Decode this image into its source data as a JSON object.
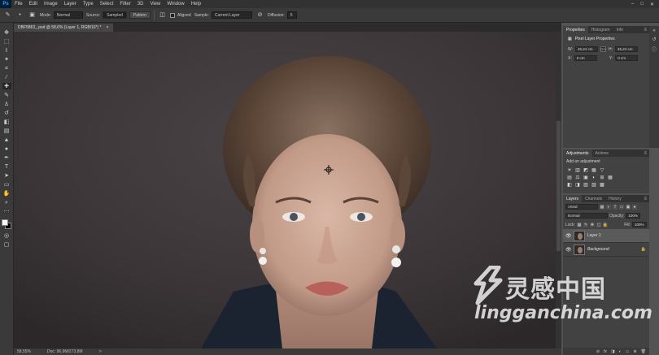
{
  "app": {
    "logo": "Ps"
  },
  "menu": [
    "File",
    "Edit",
    "Image",
    "Layer",
    "Type",
    "Select",
    "Filter",
    "3D",
    "View",
    "Window",
    "Help"
  ],
  "window_controls": [
    "–",
    "□",
    "✕"
  ],
  "options_bar": {
    "mode_label": "Mode:",
    "mode_value": "Normal",
    "source_label": "Source:",
    "sampled_label": "Sampled",
    "pattern_label": "Pattern",
    "aligned_label": "Aligned",
    "sample_label": "Sample:",
    "sample_value": "Current Layer",
    "diffusion_label": "Diffusion:",
    "diffusion_value": "5"
  },
  "document": {
    "tab_title": "DBF5863_.psd @ 58,6% (Layer 1, RGB/16*) *",
    "tab_close": "×"
  },
  "status": {
    "zoom": "58,55%",
    "doc": "Doc: 96,9M/273,8M",
    "arrow": ">"
  },
  "properties": {
    "tabs": [
      "Properties",
      "Histogram",
      "Info"
    ],
    "title": "Pixel Layer Properties",
    "w_label": "W:",
    "w_value": "45,24 cm",
    "h_label": "H:",
    "h_value": "45,24 cm",
    "link_label": "GO",
    "x_label": "X:",
    "x_value": "0 cm",
    "y_label": "Y:",
    "y_value": "0 cm"
  },
  "adjustments": {
    "tabs": [
      "Adjustments",
      "Actions"
    ],
    "label": "Add an adjustment",
    "row1": [
      "☀",
      "▥",
      "◩",
      "▦",
      "▽"
    ],
    "row2": [
      "▤",
      "⚖",
      "▣",
      "◐",
      "⊞",
      "▦"
    ],
    "row3": [
      "◧",
      "◨",
      "▧",
      "▨",
      "▩"
    ]
  },
  "layers": {
    "tabs": [
      "Layers",
      "Channels",
      "History"
    ],
    "kind_value": "Kind",
    "blend_value": "Normal",
    "opacity_label": "Opacity:",
    "opacity_value": "100%",
    "lock_label": "Lock:",
    "fill_label": "Fill:",
    "fill_value": "100%",
    "rows": [
      {
        "name": "Layer 1"
      },
      {
        "name": "Background"
      }
    ],
    "footer": [
      "⊘",
      "fx",
      "◨",
      "◐",
      "▭",
      "⊕",
      "🗑"
    ]
  },
  "watermark": {
    "cn": "灵感中国",
    "en": "lingganchina.com"
  },
  "colors": {
    "accent": "#31a8ff",
    "panel": "#424242",
    "chrome": "#3a3a3a"
  }
}
